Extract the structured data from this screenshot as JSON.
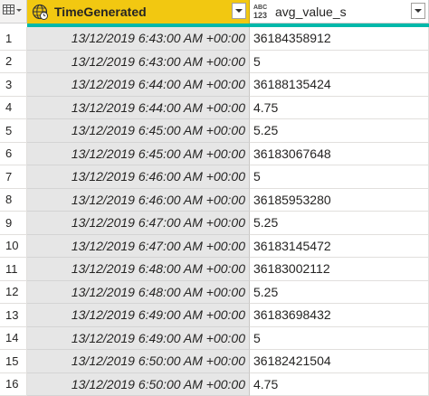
{
  "columns": {
    "time": {
      "title": "TimeGenerated",
      "type_icon": "globe-datetime-icon"
    },
    "value": {
      "title": "avg_value_s",
      "type_top": "ABC",
      "type_bottom": "123"
    }
  },
  "rows": [
    {
      "n": "1",
      "time": "13/12/2019 6:43:00 AM +00:00",
      "value": "36184358912"
    },
    {
      "n": "2",
      "time": "13/12/2019 6:43:00 AM +00:00",
      "value": "5"
    },
    {
      "n": "3",
      "time": "13/12/2019 6:44:00 AM +00:00",
      "value": "36188135424"
    },
    {
      "n": "4",
      "time": "13/12/2019 6:44:00 AM +00:00",
      "value": "4.75"
    },
    {
      "n": "5",
      "time": "13/12/2019 6:45:00 AM +00:00",
      "value": "5.25"
    },
    {
      "n": "6",
      "time": "13/12/2019 6:45:00 AM +00:00",
      "value": "36183067648"
    },
    {
      "n": "7",
      "time": "13/12/2019 6:46:00 AM +00:00",
      "value": "5"
    },
    {
      "n": "8",
      "time": "13/12/2019 6:46:00 AM +00:00",
      "value": "36185953280"
    },
    {
      "n": "9",
      "time": "13/12/2019 6:47:00 AM +00:00",
      "value": "5.25"
    },
    {
      "n": "10",
      "time": "13/12/2019 6:47:00 AM +00:00",
      "value": "36183145472"
    },
    {
      "n": "11",
      "time": "13/12/2019 6:48:00 AM +00:00",
      "value": "36183002112"
    },
    {
      "n": "12",
      "time": "13/12/2019 6:48:00 AM +00:00",
      "value": "5.25"
    },
    {
      "n": "13",
      "time": "13/12/2019 6:49:00 AM +00:00",
      "value": "36183698432"
    },
    {
      "n": "14",
      "time": "13/12/2019 6:49:00 AM +00:00",
      "value": "5"
    },
    {
      "n": "15",
      "time": "13/12/2019 6:50:00 AM +00:00",
      "value": "36182421504"
    },
    {
      "n": "16",
      "time": "13/12/2019 6:50:00 AM +00:00",
      "value": "4.75"
    }
  ],
  "colors": {
    "selected_header": "#f2c811",
    "quality_bar": "#01b8aa",
    "selected_column_fill": "#e6e6e6"
  }
}
